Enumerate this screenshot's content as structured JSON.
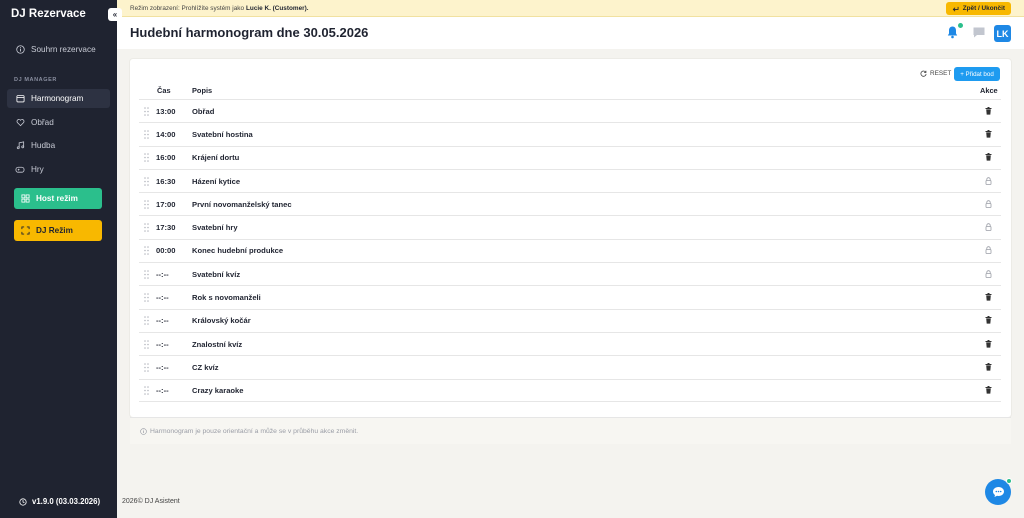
{
  "sidebar": {
    "brand": "DJ Rezervace",
    "collapse_label": "«",
    "summary_label": "Souhrn rezervace",
    "section_label": "DJ MANAGER",
    "items": [
      {
        "label": "Harmonogram",
        "icon": "calendar-icon"
      },
      {
        "label": "Obřad",
        "icon": "heart-icon"
      },
      {
        "label": "Hudba",
        "icon": "music-note-icon"
      },
      {
        "label": "Hry",
        "icon": "gamepad-icon"
      }
    ],
    "host_button": "Host režim",
    "dj_button": "DJ Režim",
    "version": "v1.9.0 (03.03.2026)"
  },
  "banner": {
    "prefix": "Režim zobrazení: Prohlížíte systém jako",
    "user": "Lucie K. (Customer).",
    "back_button": "Zpět / Ukončit"
  },
  "header": {
    "title": "Hudební harmonogram dne 30.05.2026",
    "avatar": "LK"
  },
  "toolbar": {
    "reset_label": "RESET",
    "add_label": "+ Přidat bod"
  },
  "table": {
    "col_time": "Čas",
    "col_desc": "Popis",
    "col_actions": "Akce",
    "rows": [
      {
        "time": "13:00",
        "desc": "Obřad",
        "action": "trash"
      },
      {
        "time": "14:00",
        "desc": "Svatební hostina",
        "action": "trash"
      },
      {
        "time": "16:00",
        "desc": "Krájení dortu",
        "action": "trash"
      },
      {
        "time": "16:30",
        "desc": "Házení kytice",
        "action": "lock"
      },
      {
        "time": "17:00",
        "desc": "První novomanželský tanec",
        "action": "lock"
      },
      {
        "time": "17:30",
        "desc": "Svatební hry",
        "action": "lock"
      },
      {
        "time": "00:00",
        "desc": "Konec hudební produkce",
        "action": "lock"
      },
      {
        "time": "--:--",
        "desc": "Svatební kvíz",
        "action": "lock"
      },
      {
        "time": "--:--",
        "desc": "Rok s novomanželi",
        "action": "trash"
      },
      {
        "time": "--:--",
        "desc": "Královský kočár",
        "action": "trash"
      },
      {
        "time": "--:--",
        "desc": "Znalostní kvíz",
        "action": "trash"
      },
      {
        "time": "--:--",
        "desc": "CZ kvíz",
        "action": "trash"
      },
      {
        "time": "--:--",
        "desc": "Crazy karaoke",
        "action": "trash"
      }
    ]
  },
  "note": "Harmonogram je pouze orientační a může se v průběhu akce změnit.",
  "footer": "2026© DJ Asistent",
  "colors": {
    "sidebar_bg": "#1f2330",
    "accent_green": "#2bbf8c",
    "accent_yellow": "#f8b800",
    "accent_blue": "#1e9bf0",
    "banner_bg": "#fdf3cc"
  }
}
